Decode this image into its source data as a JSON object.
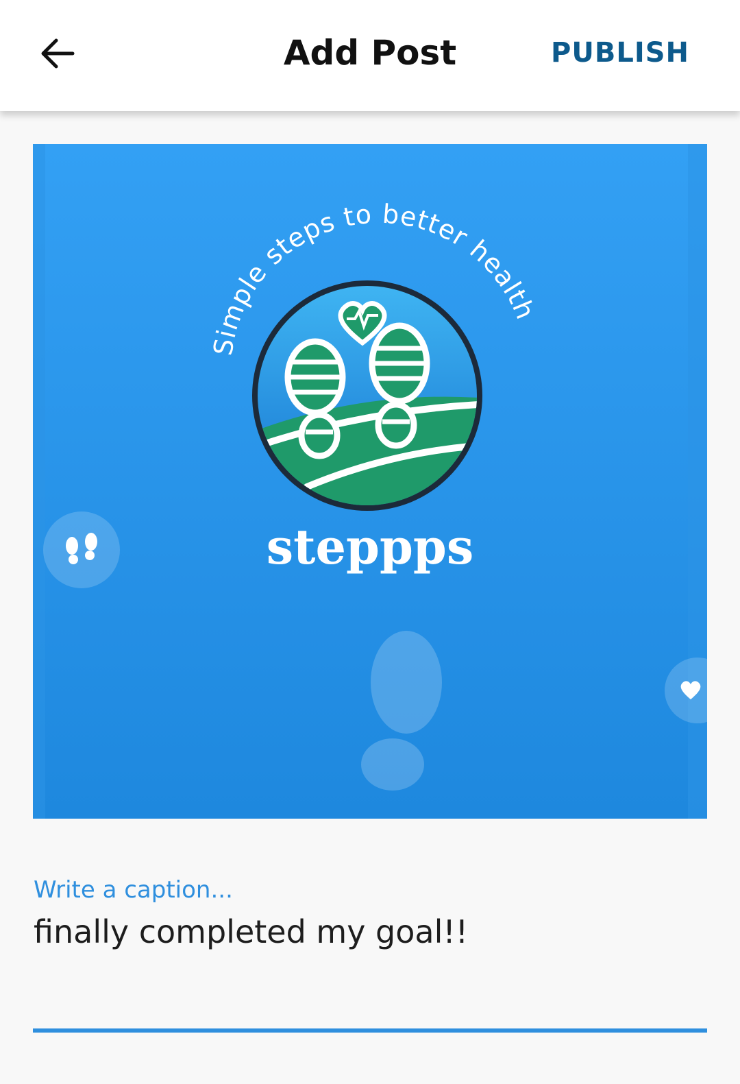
{
  "header": {
    "title": "Add Post",
    "publish_label": "PUBLISH",
    "back_icon": "arrow-left-icon"
  },
  "post_image": {
    "brand_name": "steppps",
    "tagline": "Simple steps to better health",
    "background_color": "#2f96ec",
    "accent_green": "#1f9a6a"
  },
  "caption": {
    "label": "Write a caption...",
    "value": "finally completed my goal!!",
    "accent_color": "#2f8fde"
  },
  "colors": {
    "publish": "#0d5a8c",
    "appbar": "#ffffff",
    "page_background": "#f8f8f8"
  }
}
